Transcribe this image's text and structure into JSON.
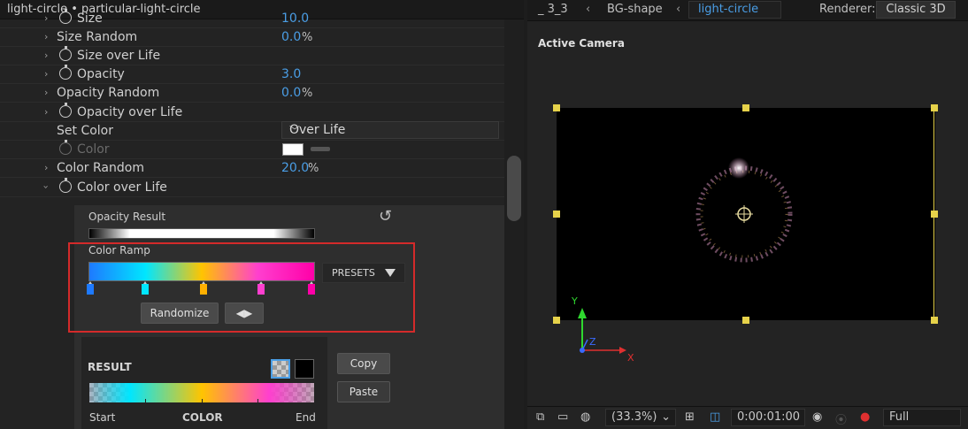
{
  "left_panel": {
    "title": "light-circle • particular-light-circle",
    "rows": [
      {
        "label": "Size",
        "value": "10.0",
        "pct": ""
      },
      {
        "label": "Size Random",
        "value": "0.0",
        "pct": "%"
      },
      {
        "label": "Size over Life",
        "value": "",
        "pct": ""
      },
      {
        "label": "Opacity",
        "value": "3.0",
        "pct": ""
      },
      {
        "label": "Opacity Random",
        "value": "0.0",
        "pct": "%"
      },
      {
        "label": "Opacity over Life",
        "value": "",
        "pct": ""
      },
      {
        "label": "Set Color",
        "value": "",
        "pct": ""
      },
      {
        "label": "Color",
        "value": "",
        "pct": ""
      },
      {
        "label": "Color Random",
        "value": "20.0",
        "pct": "%"
      },
      {
        "label": "Color over Life",
        "value": "",
        "pct": ""
      }
    ],
    "set_color_select": "Over Life",
    "color_swatch": "#ffffff",
    "gradient_editor": {
      "opacity_result_label": "Opacity Result",
      "color_ramp_label": "Color Ramp",
      "presets_label": "PRESETS",
      "randomize_label": "Randomize",
      "stop_colors": [
        "#1e7aff",
        "#00e6ff",
        "#ffb000",
        "#ff3fcf",
        "#ff00a8"
      ],
      "result_label": "RESULT",
      "copy_label": "Copy",
      "paste_label": "Paste",
      "start_label": "Start",
      "color_label": "COLOR",
      "end_label": "End"
    }
  },
  "right_panel": {
    "breadcrumbs": [
      "_ 3_3",
      "BG-shape",
      "light-circle"
    ],
    "renderer_label": "Renderer:",
    "renderer_value": "Classic 3D",
    "view_label": "Active Camera",
    "axis_labels": {
      "x": "X",
      "y": "Y",
      "z": "Z"
    },
    "bottom_bar": {
      "zoom": "(33.3%)",
      "timecode": "0:00:01:00",
      "resolution": "Full"
    }
  },
  "colors": {
    "accent_blue": "#4a9ee6",
    "highlight_red": "#d42a2a",
    "handle_yellow": "#e6d24a"
  }
}
